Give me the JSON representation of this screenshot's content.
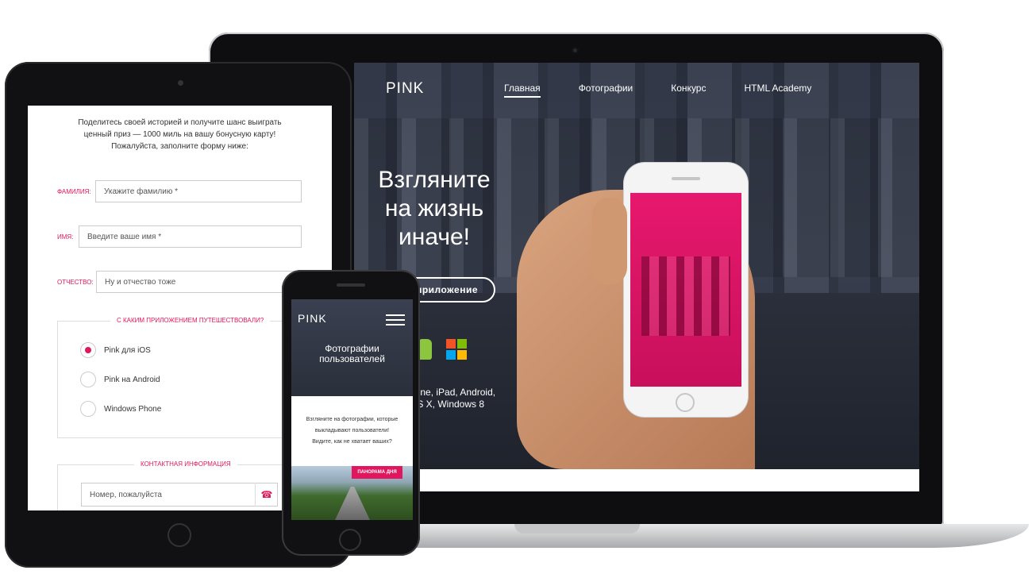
{
  "laptop": {
    "site_logo": "PINK",
    "nav": [
      "Главная",
      "Фотографии",
      "Конкурс",
      "HTML Academy"
    ],
    "hero_title_lines": [
      "Взгляните",
      "на жизнь",
      "иначе!"
    ],
    "app_button_label": "приложение",
    "platform_text_lines": [
      "hone, iPad, Android,",
      "OS X, Windows 8"
    ],
    "android_color": "#8cc63f",
    "windows_colors": [
      "#f35325",
      "#81bc06",
      "#05a6f0",
      "#ffba08"
    ]
  },
  "tablet": {
    "intro_lines": [
      "Поделитесь своей историей и получите шанс выиграть",
      "ценный приз — 1000 миль на вашу бонусную карту!",
      "Пожалуйста, заполните форму ниже:"
    ],
    "fields": [
      {
        "label": "фамилия:",
        "placeholder": "Укажите фамилию *"
      },
      {
        "label": "имя:",
        "placeholder": "Введите ваше имя *"
      },
      {
        "label": "отчество:",
        "placeholder": "Ну и отчество тоже"
      }
    ],
    "app_legend": "с каким приложением путешествовали?",
    "radio_options": [
      {
        "label": "Pink для iOS",
        "checked": true
      },
      {
        "label": "Pink на Android",
        "checked": false
      },
      {
        "label": "Windows Phone",
        "checked": false
      }
    ],
    "contact_legend": "контактная информация",
    "phone_placeholder": "Номер, пожалуйста",
    "phone_icon": "phone-icon"
  },
  "phone": {
    "logo": "PINK",
    "menu_icon": "hamburger-icon",
    "title_lines": [
      "Фотографии",
      "пользователей"
    ],
    "text_lines": [
      "Взгляните на фотографии, которые",
      "выкладывают пользователи!",
      "Видите, как не хватает ваших?"
    ],
    "badge": "ПАНОРАМА ДНЯ"
  },
  "colors": {
    "accent": "#e0165e"
  }
}
